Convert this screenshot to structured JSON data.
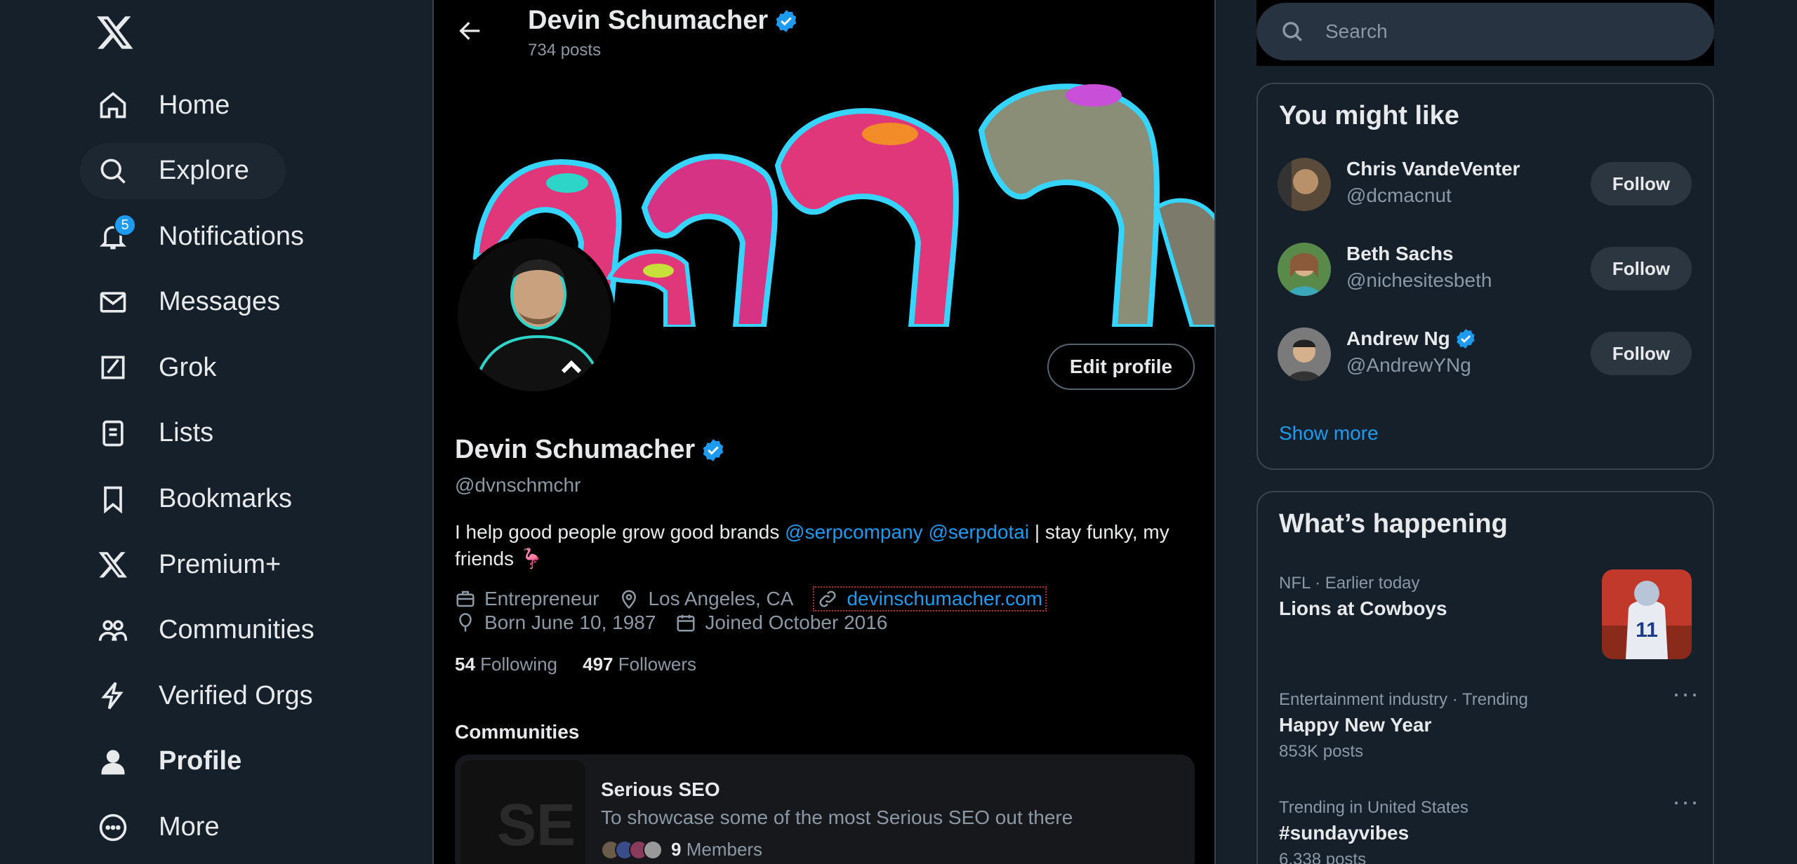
{
  "nav": {
    "items": [
      {
        "label": "Home",
        "icon": "home-icon"
      },
      {
        "label": "Explore",
        "icon": "search-icon"
      },
      {
        "label": "Notifications",
        "icon": "bell-icon",
        "badge": "5"
      },
      {
        "label": "Messages",
        "icon": "mail-icon"
      },
      {
        "label": "Grok",
        "icon": "grok-icon"
      },
      {
        "label": "Lists",
        "icon": "lists-icon"
      },
      {
        "label": "Bookmarks",
        "icon": "bookmark-icon"
      },
      {
        "label": "Premium+",
        "icon": "x-logo-icon"
      },
      {
        "label": "Communities",
        "icon": "communities-icon"
      },
      {
        "label": "Verified Orgs",
        "icon": "lightning-icon"
      },
      {
        "label": "Profile",
        "icon": "person-icon"
      },
      {
        "label": "More",
        "icon": "more-circle-icon"
      }
    ]
  },
  "header": {
    "name": "Devin Schumacher",
    "posts": "734 posts"
  },
  "profile": {
    "name": "Devin Schumacher",
    "handle": "@dvnschmchr",
    "edit_label": "Edit profile",
    "bio_prefix": "I help good people grow good brands ",
    "bio_mention1": "@serpcompany",
    "bio_mention2": "@serpdotai",
    "bio_suffix": " | stay funky, my friends 🦩",
    "occupation": "Entrepreneur",
    "location": "Los Angeles, CA",
    "website": "devinschumacher.com",
    "born": "Born June 10, 1987",
    "joined": "Joined October 2016",
    "following_count": "54",
    "following_label": "Following",
    "followers_count": "497",
    "followers_label": "Followers"
  },
  "communities": {
    "title": "Communities",
    "name": "Serious SEO",
    "description": "To showcase some of the most Serious SEO out there",
    "thumb_text": "SE",
    "members_count": "9",
    "members_label": "Members"
  },
  "search": {
    "placeholder": "Search"
  },
  "you_might_like": {
    "title": "You might like",
    "follow_label": "Follow",
    "show_more": "Show more",
    "users": [
      {
        "name": "Chris VandeVenter",
        "handle": "@dcmacnut",
        "verified": false
      },
      {
        "name": "Beth Sachs",
        "handle": "@nichesitesbeth",
        "verified": false
      },
      {
        "name": "Andrew Ng",
        "handle": "@AndrewYNg",
        "verified": true
      }
    ]
  },
  "whats_happening": {
    "title": "What’s happening",
    "trends": [
      {
        "context": "NFL · Earlier today",
        "title": "Lions at Cowboys",
        "posts": ""
      },
      {
        "context": "Entertainment industry · Trending",
        "title": "Happy New Year",
        "posts": "853K posts"
      },
      {
        "context": "Trending in United States",
        "title": "#sundayvibes",
        "posts": "6,338 posts"
      }
    ]
  },
  "colors": {
    "accent": "#1d9bf0",
    "background": "#15202b",
    "main_bg": "#000000",
    "text": "#e7e9ea",
    "muted": "#8b98a5"
  }
}
